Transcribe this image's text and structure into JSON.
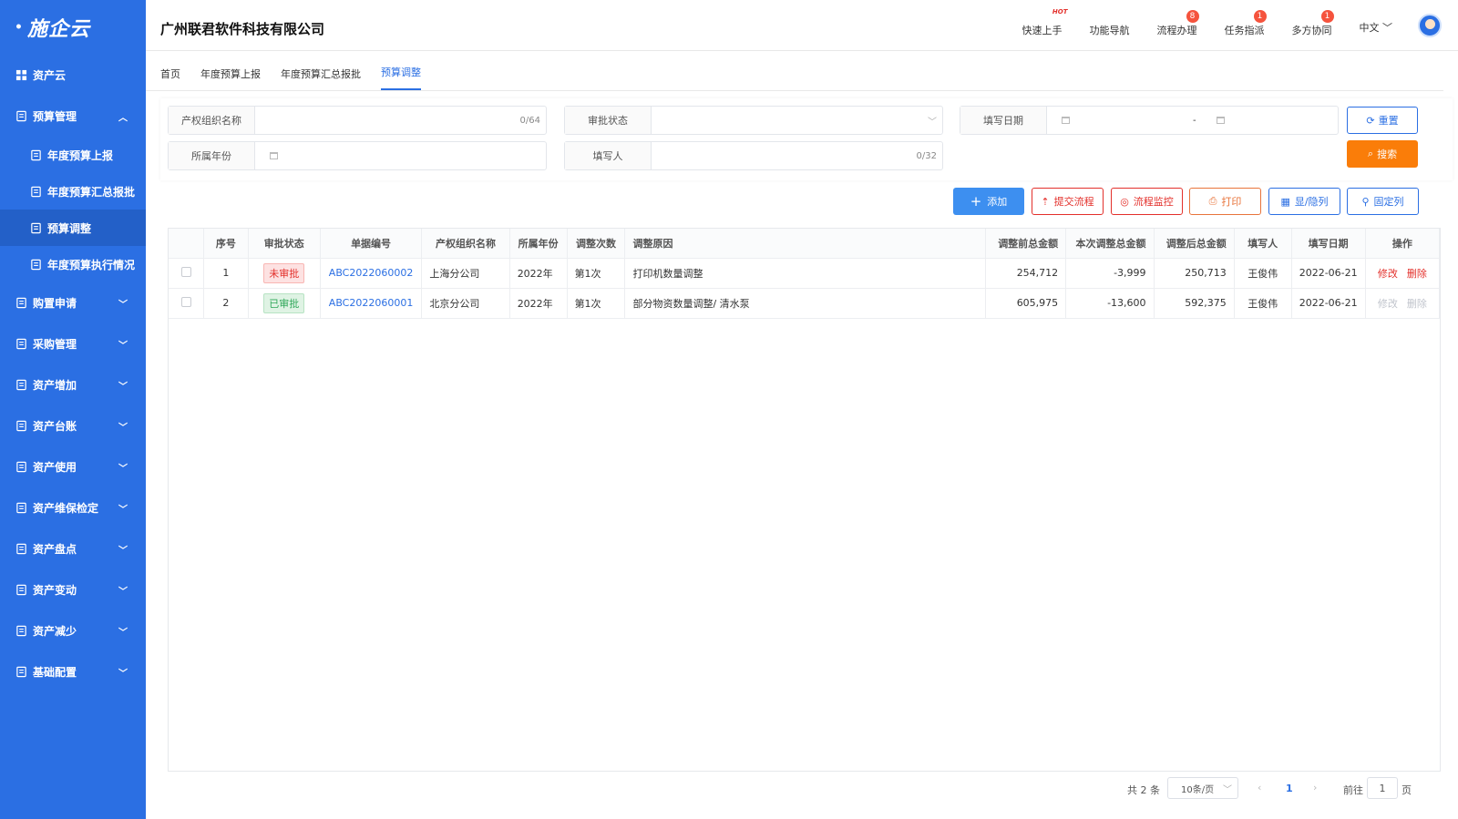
{
  "sidebar": {
    "logo": "施企云",
    "items": [
      {
        "label": "资产云",
        "icon": "grid-icon",
        "arrow": ""
      },
      {
        "label": "预算管理",
        "icon": "budget-icon",
        "arrow": "︿"
      },
      {
        "label": "年度预算上报",
        "icon": "report-icon",
        "sub": true
      },
      {
        "label": "年度预算汇总报批",
        "icon": "summary-icon",
        "sub": true
      },
      {
        "label": "预算调整",
        "icon": "doc-icon",
        "sub": true,
        "active": true
      },
      {
        "label": "年度预算执行情况",
        "icon": "exec-icon",
        "sub": true
      },
      {
        "label": "购置申请",
        "icon": "cube-icon",
        "arrow": "﹀"
      },
      {
        "label": "采购管理",
        "icon": "clipboard-icon",
        "arrow": "﹀"
      },
      {
        "label": "资产增加",
        "icon": "home-icon",
        "arrow": "﹀"
      },
      {
        "label": "资产台账",
        "icon": "ledger-icon",
        "arrow": "﹀"
      },
      {
        "label": "资产使用",
        "icon": "layers-icon",
        "arrow": "﹀"
      },
      {
        "label": "资产维保检定",
        "icon": "cube-icon",
        "arrow": "﹀"
      },
      {
        "label": "资产盘点",
        "icon": "ledger-icon",
        "arrow": "﹀"
      },
      {
        "label": "资产变动",
        "icon": "apps-icon",
        "arrow": "﹀"
      },
      {
        "label": "资产减少",
        "icon": "clipboard-icon",
        "arrow": "﹀"
      },
      {
        "label": "基础配置",
        "icon": "apps-icon",
        "arrow": "﹀"
      }
    ]
  },
  "header": {
    "company": "广州联君软件科技有限公司",
    "nav": [
      {
        "label": "快速上手",
        "hot": "HOT"
      },
      {
        "label": "功能导航"
      },
      {
        "label": "流程办理",
        "badge": "8"
      },
      {
        "label": "任务指派",
        "badge": "1"
      },
      {
        "label": "多方协同",
        "badge": "1"
      }
    ],
    "lang": "中文 ﹀"
  },
  "tabs": [
    "首页",
    "年度预算上报",
    "年度预算汇总报批",
    "预算调整"
  ],
  "filters": {
    "org_label": "产权组织名称",
    "org_count": "0/64",
    "status_label": "审批状态",
    "date_label": "填写日期",
    "date_sep": "-",
    "year_label": "所属年份",
    "writer_label": "填写人",
    "writer_count": "0/32",
    "reset": "重置",
    "search": "搜索"
  },
  "toolbar": {
    "add": "添加",
    "submit": "提交流程",
    "monitor": "流程监控",
    "print": "打印",
    "toggle": "显/隐列",
    "fix": "固定列"
  },
  "table": {
    "headers": [
      "序号",
      "审批状态",
      "单据编号",
      "产权组织名称",
      "所属年份",
      "调整次数",
      "调整原因",
      "调整前总金额",
      "本次调整总金额",
      "调整后总金额",
      "填写人",
      "填写日期",
      "操作"
    ],
    "rows": [
      {
        "no": "1",
        "status": "未审批",
        "code": "ABC2022060002",
        "org": "上海分公司",
        "year": "2022年",
        "times": "第1次",
        "reason": "打印机数量调整",
        "before": "254,712",
        "change": "-3,999",
        "after": "250,713",
        "writer": "王俊伟",
        "date": "2022-06-21",
        "edit": "修改",
        "del": "删除"
      },
      {
        "no": "2",
        "status": "已审批",
        "code": "ABC2022060001",
        "org": "北京分公司",
        "year": "2022年",
        "times": "第1次",
        "reason": "部分物资数量调整/ 清水泵",
        "before": "605,975",
        "change": "-13,600",
        "after": "592,375",
        "writer": "王俊伟",
        "date": "2022-06-21",
        "edit": "修改",
        "del": "删除"
      }
    ]
  },
  "pager": {
    "total": "共 2 条",
    "size": "10条/页",
    "page": "1",
    "goto": "前往",
    "goto_val": "1",
    "unit": "页"
  }
}
